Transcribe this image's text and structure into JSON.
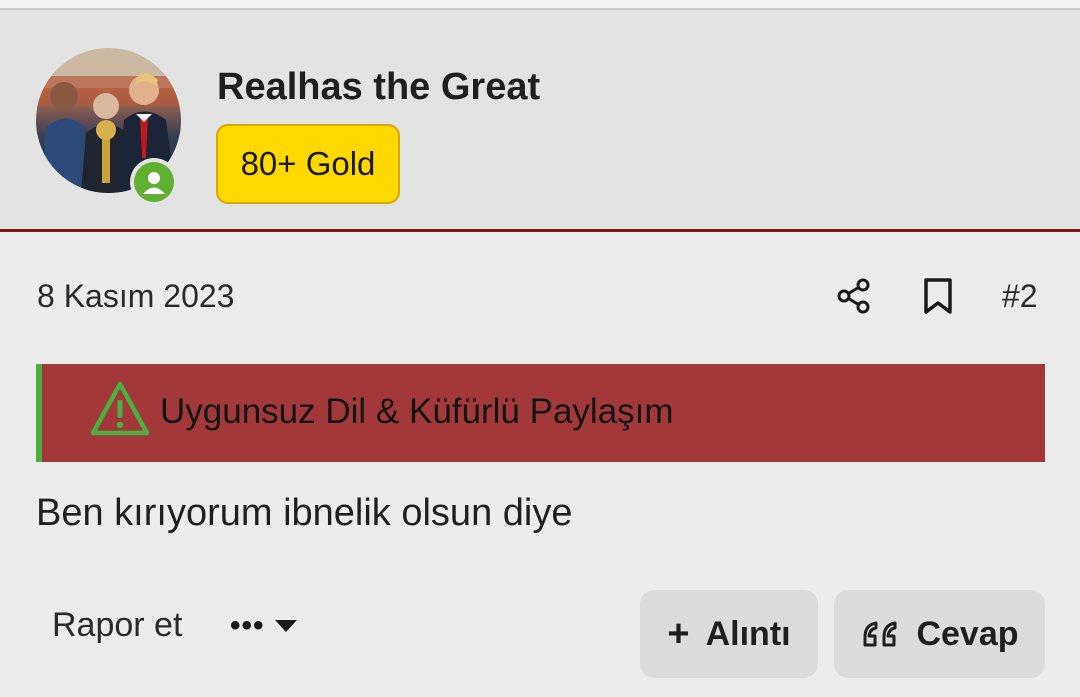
{
  "post": {
    "author": {
      "name": "Realhas the Great",
      "badge": "80+ Gold",
      "status": "online"
    },
    "date": "8 Kasım 2023",
    "number": "#2",
    "warning": {
      "icon": "warning-triangle-icon",
      "text": "Uygunsuz Dil & Küfürlü Paylaşım"
    },
    "message": "Ben kırıyorum ibnelik olsun diye"
  },
  "actions": {
    "report_label": "Rapor et",
    "more_label": "•••",
    "quote_label": "Alıntı",
    "reply_label": "Cevap"
  },
  "colors": {
    "badge_bg": "#ffd800",
    "warning_bg": "#a2383a",
    "warning_accent": "#4caf3f",
    "online": "#5fb030",
    "header_border": "#7a1b1b"
  }
}
